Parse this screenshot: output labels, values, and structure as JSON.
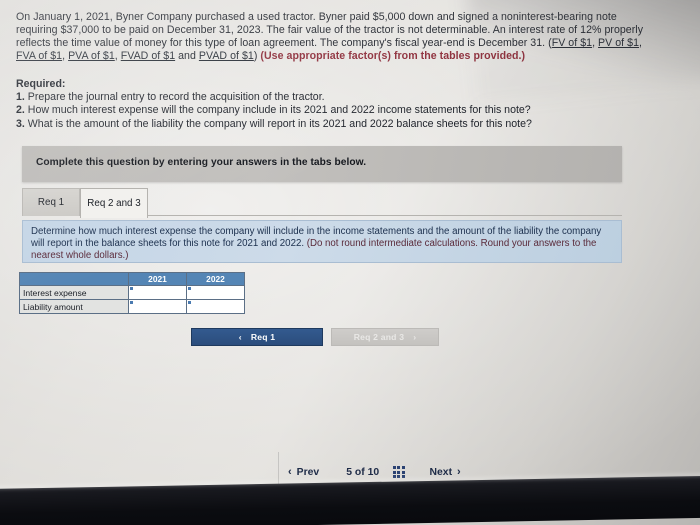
{
  "problem": {
    "line1_a": "On January 1, 2021, Byner Company purchased a used tractor. Byner paid $5,000 down and signed a noninterest-bearing note requiring $37,000 to be paid on December 31, 2023. The fair value of the tractor is not determinable. An interest rate of 12% properly reflects the time value of money for this type of loan agreement. The company's fiscal year-end is December 31. (",
    "link_fv": "FV of $1",
    "sep1": ", ",
    "link_pv": "PV of $1",
    "sep2": ", ",
    "link_fva": "FVA of $1",
    "sep3": ", ",
    "link_pva": "PVA of $1",
    "sep4": ", ",
    "link_fvad": "FVAD of $1",
    "sep5": " and ",
    "link_pvad": "PVAD of $1",
    "close_paren": ") ",
    "red_note": "(Use appropriate factor(s) from the tables provided.)"
  },
  "required": {
    "title": "Required:",
    "items": [
      {
        "num": "1.",
        "text": "Prepare the journal entry to record the acquisition of the tractor."
      },
      {
        "num": "2.",
        "text": "How much interest expense will the company include in its 2021 and 2022 income statements for this note?"
      },
      {
        "num": "3.",
        "text": "What is the amount of the liability the company will report in its 2021 and 2022 balance sheets for this note?"
      }
    ]
  },
  "gray_panel": {
    "text": "Complete this question by entering your answers in the tabs below."
  },
  "tabs": [
    {
      "label": "Req 1",
      "active": false
    },
    {
      "label": "Req 2 and 3",
      "active": true
    }
  ],
  "instruction_box": {
    "main": "Determine how much interest expense the company will include in the income statements and the amount of the liability the company will report in the balance sheets for this note for 2021 and 2022. ",
    "paren": "(Do not round intermediate calculations. Round your answers to the nearest whole dollars.)"
  },
  "answer_table": {
    "columns": [
      "",
      "2021",
      "2022"
    ],
    "rows": [
      {
        "label": "Interest expense",
        "values": [
          "",
          ""
        ]
      },
      {
        "label": "Liability amount",
        "values": [
          "",
          ""
        ]
      }
    ]
  },
  "req_nav": {
    "prev_label": "Req 1",
    "prev_chevron": "‹",
    "next_label": "Req 2 and 3",
    "next_chevron": "›"
  },
  "pager": {
    "prev_label": "Prev",
    "prev_chevron": "‹",
    "count_label": "5 of 10",
    "grid_icon": "grid-icon",
    "next_label": "Next",
    "next_chevron": "›"
  },
  "colors": {
    "table_header_blue": "#5485b5",
    "primary_button": "#2b4d7c",
    "instruction_blue": "#c4d5e6",
    "red_note": "#8c2b38"
  }
}
